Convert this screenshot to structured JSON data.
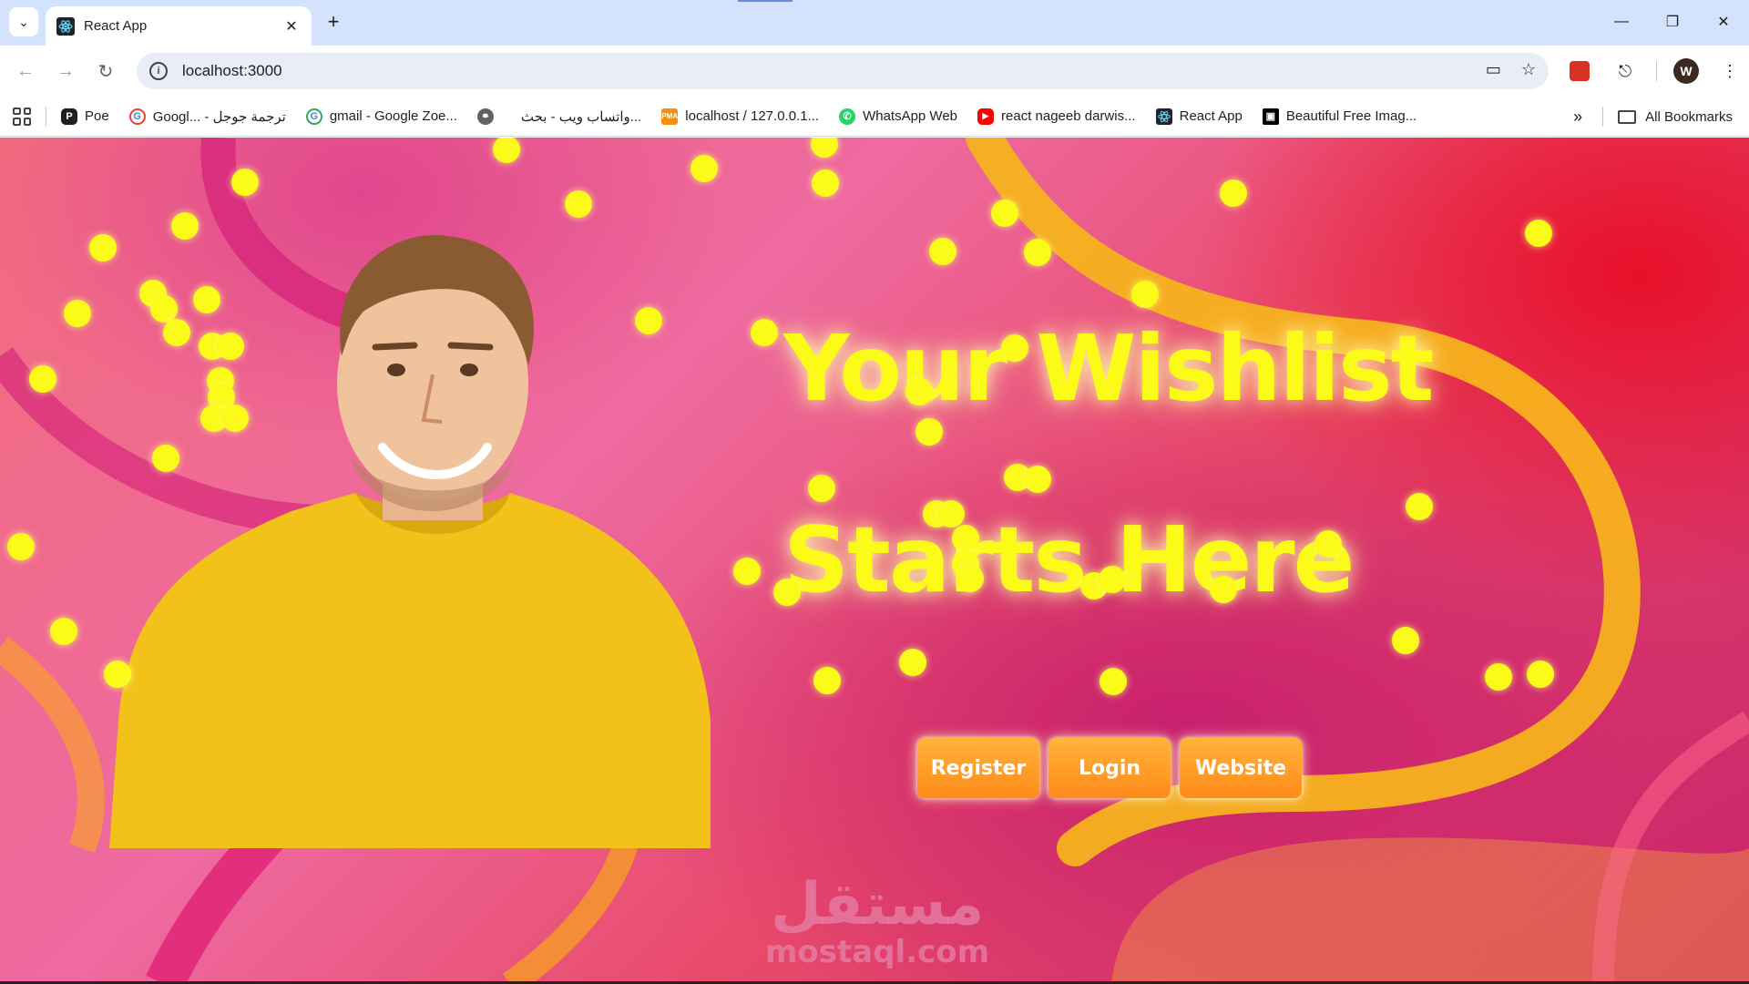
{
  "browser": {
    "tab": {
      "title": "React App",
      "close_icon": "close-icon"
    },
    "new_tab_icon": "plus-icon",
    "window_controls": [
      "minimize-icon",
      "restore-icon",
      "close-icon"
    ],
    "omnibox": {
      "url": "localhost:3000"
    },
    "profile_initial": "W",
    "bookmarks": [
      {
        "label": "Poe",
        "icon": "poe-icon",
        "color": "#1f1f1f"
      },
      {
        "label": "Googl... - ترجمة جوجل",
        "icon": "google-icon",
        "color": "#4285f4"
      },
      {
        "label": "gmail - Google Zoe...",
        "icon": "google-icon",
        "color": "#4285f4"
      },
      {
        "label": "",
        "icon": "globe-icon",
        "color": "#5f6368"
      },
      {
        "label": "واتساب ويب - بحث...",
        "icon": "",
        "color": ""
      },
      {
        "label": "localhost / 127.0.0.1...",
        "icon": "phpmyadmin-icon",
        "color": "#f29111"
      },
      {
        "label": "WhatsApp Web",
        "icon": "whatsapp-icon",
        "color": "#25d366"
      },
      {
        "label": "react nageeb darwis...",
        "icon": "youtube-icon",
        "color": "#ff0000"
      },
      {
        "label": "React App",
        "icon": "react-icon",
        "color": "#20232a"
      },
      {
        "label": "Beautiful Free Imag...",
        "icon": "unsplash-icon",
        "color": "#000000"
      }
    ],
    "all_bookmarks": "All Bookmarks"
  },
  "hero": {
    "title_line1": "Your Wishlist",
    "title_line2": "Starts Here",
    "buttons": {
      "register": "Register",
      "login": "Login",
      "website": "Website"
    }
  },
  "watermark": {
    "arabic": "مستقل",
    "latin": "mostaql.com"
  },
  "colors": {
    "accent_yellow": "#fbfa19",
    "button_orange": "#ff8a1a",
    "tab_strip": "#d3e3fd"
  }
}
